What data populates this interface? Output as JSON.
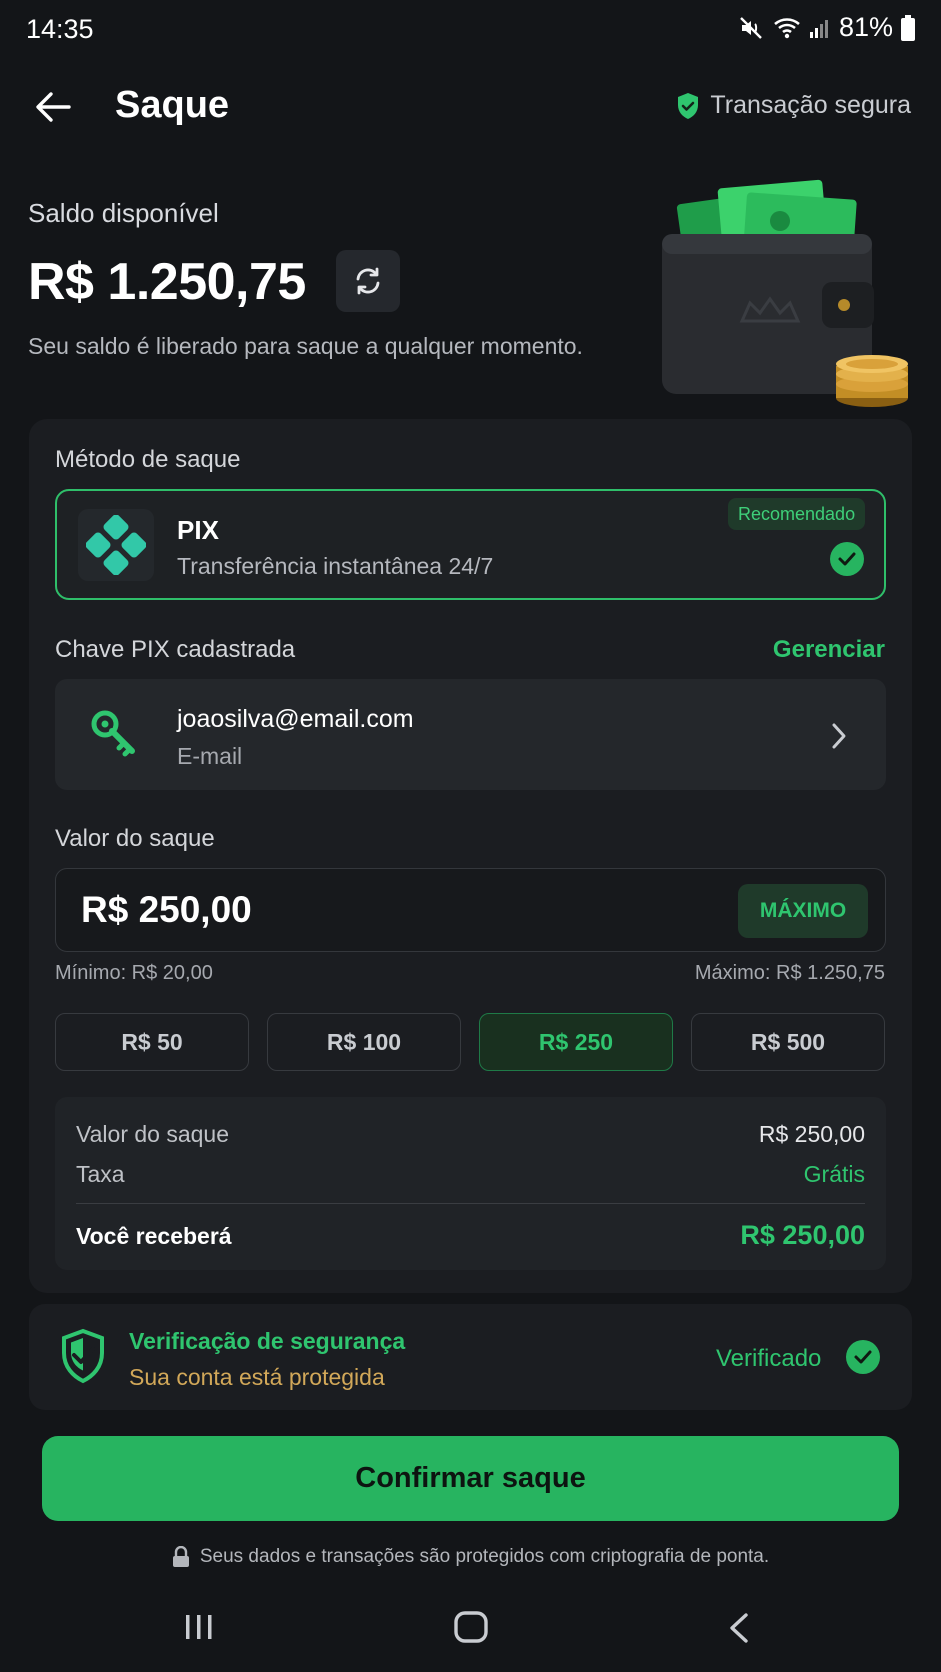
{
  "status_bar": {
    "time": "14:35",
    "battery": "81%"
  },
  "header": {
    "title": "Saque",
    "secure_label": "Transação segura"
  },
  "balance": {
    "label": "Saldo disponível",
    "amount": "R$ 1.250,75",
    "subtitle": "Seu saldo é liberado para saque a qualquer momento."
  },
  "method": {
    "label": "Método de saque",
    "name": "PIX",
    "description": "Transferência instantânea 24/7",
    "badge": "Recomendado",
    "selected": true
  },
  "pix_key": {
    "label": "Chave PIX cadastrada",
    "manage_label": "Gerenciar",
    "value": "joaosilva@email.com",
    "type": "E-mail"
  },
  "amount": {
    "label": "Valor do saque",
    "value": "R$ 250,00",
    "max_button": "MÁXIMO",
    "min_text": "Mínimo: R$ 20,00",
    "max_text": "Máximo: R$ 1.250,75",
    "quick_values": [
      "R$ 50",
      "R$ 100",
      "R$ 250",
      "R$ 500"
    ],
    "selected_quick_index": 2
  },
  "summary": {
    "rows": [
      {
        "label": "Valor do saque",
        "value": "R$ 250,00"
      },
      {
        "label": "Taxa",
        "value": "Grátis"
      }
    ],
    "total_label": "Você receberá",
    "total_value": "R$ 250,00"
  },
  "security": {
    "title": "Verificação de segurança",
    "subtitle": "Sua conta está protegida",
    "status": "Verificado"
  },
  "confirm_button": "Confirmar saque",
  "footer_note": "Seus dados e transações são protegidos com criptografia de ponta.",
  "colors": {
    "background": "#131518",
    "card": "#1b1d21",
    "accent_green": "#27b460",
    "warning_gold": "#d2a859"
  },
  "icons": [
    "back-arrow-icon",
    "shield-check-icon",
    "refresh-icon",
    "pix-icon",
    "check-icon",
    "key-icon",
    "chevron-right-icon",
    "lock-icon"
  ]
}
